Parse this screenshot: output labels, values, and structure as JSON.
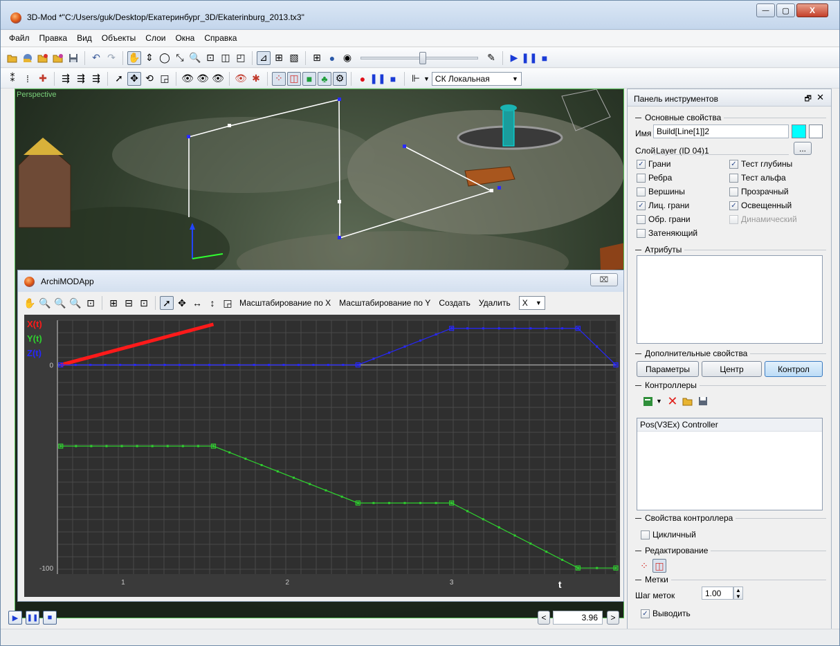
{
  "window": {
    "title": "3D-Mod *\"C:/Users/guk/Desktop/Екатеринбург_3D/Ekaterinburg_2013.tx3\"",
    "minimize_glyph": "—",
    "maximize_glyph": "▢",
    "close_glyph": "X"
  },
  "menu": [
    "Файл",
    "Правка",
    "Вид",
    "Объекты",
    "Слои",
    "Окна",
    "Справка"
  ],
  "toolbar2": {
    "cs_combo": "СК Локальная"
  },
  "viewport": {
    "label": "Perspective"
  },
  "graph_window": {
    "title": "ArchiMODApp",
    "close_glyph": "⌧",
    "buttons": {
      "scale_x": "Масштабирование по X",
      "scale_y": "Масштабирование по Y",
      "create": "Создать",
      "delete": "Удалить"
    },
    "axis_combo": "X"
  },
  "chart_data": {
    "type": "line",
    "xlim": [
      0.6,
      4.0
    ],
    "ylim": [
      -103,
      22
    ],
    "x_ticks": [
      "1",
      "2",
      "3"
    ],
    "y_ticks": [
      "0",
      "-100"
    ],
    "x_axis_label": "t",
    "legend": [
      "X(t)",
      "Y(t)",
      "Z(t)"
    ],
    "colors": {
      "x": "#ff1a1a",
      "y": "#2fd12f",
      "z": "#2626ff"
    },
    "series": [
      {
        "name": "X(t)",
        "x": [
          0.62,
          1.55
        ],
        "y": [
          0,
          20
        ]
      },
      {
        "name": "Y(t)",
        "x": [
          0.62,
          1.55,
          2.43,
          3.0,
          3.77,
          4.0
        ],
        "y": [
          -40,
          -40,
          -68,
          -68,
          -100,
          -100
        ]
      },
      {
        "name": "Z(t)",
        "x": [
          0.62,
          2.43,
          3.0,
          3.77,
          4.0
        ],
        "y": [
          0,
          0,
          18,
          18,
          0
        ]
      }
    ]
  },
  "playback": {
    "time_value": "3.96",
    "prev_glyph": "<",
    "next_glyph": ">"
  },
  "panel": {
    "title": "Панель инструментов",
    "dock_glyph": "🗗",
    "close_glyph": "✕",
    "basic_props": "Основные свойства",
    "name_label": "Имя",
    "name_value": "Build[Line[1]]2",
    "layer_label": "Слой",
    "layer_value": "Layer (ID 04)1",
    "layer_btn": "...",
    "color_fill": "#00ffff",
    "checkboxes": [
      {
        "label": "Грани",
        "checked": true
      },
      {
        "label": "Тест глубины",
        "checked": true
      },
      {
        "label": "Ребра",
        "checked": false
      },
      {
        "label": "Тест альфа",
        "checked": false
      },
      {
        "label": "Вершины",
        "checked": false
      },
      {
        "label": "Прозрачный",
        "checked": false
      },
      {
        "label": "Лиц. грани",
        "checked": true
      },
      {
        "label": "Освещенный",
        "checked": true
      },
      {
        "label": "Обр. грани",
        "checked": false
      },
      {
        "label": "Динамический",
        "checked": false
      },
      {
        "label": "Затеняющий",
        "checked": false
      }
    ],
    "attributes": "Атрибуты",
    "extra_props": "Дополнительные свойства",
    "buttons": {
      "params": "Параметры",
      "center": "Центр",
      "control": "Контрол"
    },
    "controllers": "Контроллеры",
    "controller_items": [
      "Pos(V3Ex) Controller"
    ],
    "controller_props": "Свойства контроллера",
    "cyclic_label": "Цикличный",
    "cyclic_checked": false,
    "editing": "Редактирование",
    "marks": "Метки",
    "step_label": "Шаг меток",
    "step_value": "1.00",
    "show_label": "Выводить",
    "show_checked": true
  }
}
